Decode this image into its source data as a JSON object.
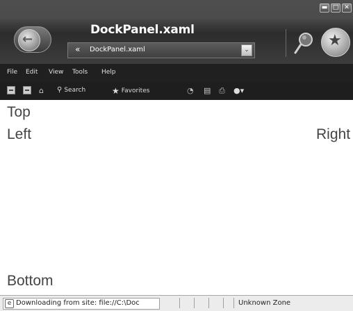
{
  "window": {
    "title": "DockPanel.xaml",
    "controls": {
      "minimize": "▬",
      "maximize": "□",
      "close": "✕"
    }
  },
  "address_bar": {
    "chevron": "«",
    "value": "DockPanel.xaml",
    "dropdown_glyph": "⌄"
  },
  "menu": {
    "items": [
      "File",
      "Edit",
      "View",
      "Tools",
      "Help"
    ]
  },
  "toolbar": {
    "search_label": "Search",
    "favorites_label": "Favorites"
  },
  "content": {
    "top": "Top",
    "left": "Left",
    "right": "Right",
    "bottom": "Bottom"
  },
  "status_bar": {
    "message": "Downloading from site: file://C:\\Doc",
    "zone": "Unknown Zone"
  },
  "icons": [
    "back-arrow-icon",
    "search-magnifier-icon",
    "favorites-star-icon",
    "stop-icon",
    "refresh-icon",
    "home-icon",
    "history-icon",
    "media-icon",
    "print-icon",
    "messenger-icon",
    "ie-page-icon"
  ]
}
